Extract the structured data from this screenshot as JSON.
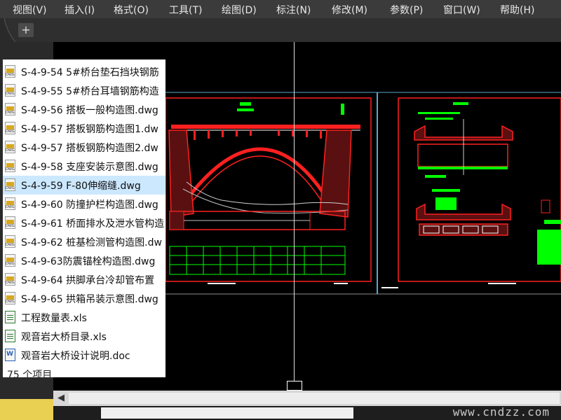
{
  "menubar": {
    "items": [
      "视图(V)",
      "插入(I)",
      "格式(O)",
      "工具(T)",
      "绘图(D)",
      "标注(N)",
      "修改(M)",
      "参数(P)",
      "窗口(W)",
      "帮助(H)"
    ]
  },
  "tabs": {
    "add_label": "+"
  },
  "file_list": {
    "selected_index": 7,
    "items": [
      {
        "name": "S-4-9-54 5#桥台垫石挡块钢筋",
        "type": "dwg"
      },
      {
        "name": "S-4-9-55 5#桥台耳墙钢筋构造",
        "type": "dwg"
      },
      {
        "name": "S-4-9-56 搭板一般构造图.dwg",
        "type": "dwg"
      },
      {
        "name": "S-4-9-57 搭板钢筋构造图1.dw",
        "type": "dwg"
      },
      {
        "name": "S-4-9-57 搭板钢筋构造图2.dw",
        "type": "dwg"
      },
      {
        "name": "S-4-9-58  支座安装示意图.dwg",
        "type": "dwg"
      },
      {
        "name": "S-4-9-59  F-80伸缩缝.dwg",
        "type": "dwg"
      },
      {
        "name": "S-4-9-60 防撞护栏构造图.dwg",
        "type": "dwg"
      },
      {
        "name": "S-4-9-61 桥面排水及泄水管构造",
        "type": "dwg"
      },
      {
        "name": "S-4-9-62 桩基检测管构造图.dw",
        "type": "dwg"
      },
      {
        "name": "S-4-9-63防震锚栓构造图.dwg",
        "type": "dwg"
      },
      {
        "name": "S-4-9-64 拱脚承台冷却管布置",
        "type": "dwg"
      },
      {
        "name": "S-4-9-65 拱箱吊装示意图.dwg",
        "type": "dwg"
      },
      {
        "name": "工程数量表.xls",
        "type": "xls"
      },
      {
        "name": "观音岩大桥目录.xls",
        "type": "xls"
      },
      {
        "name": "观音岩大桥设计说明.doc",
        "type": "doc"
      }
    ],
    "count_text": "75 个项目"
  },
  "statusbar": {
    "watermark": "www.cndzz.com"
  },
  "colors": {
    "frame": "#e9cf52",
    "canvas": "#000000",
    "cad_red": "#ff2020",
    "cad_green": "#00ff00",
    "cad_white": "#ffffff",
    "cad_cyan": "#5aa9c9",
    "selection": "#cce8ff"
  }
}
